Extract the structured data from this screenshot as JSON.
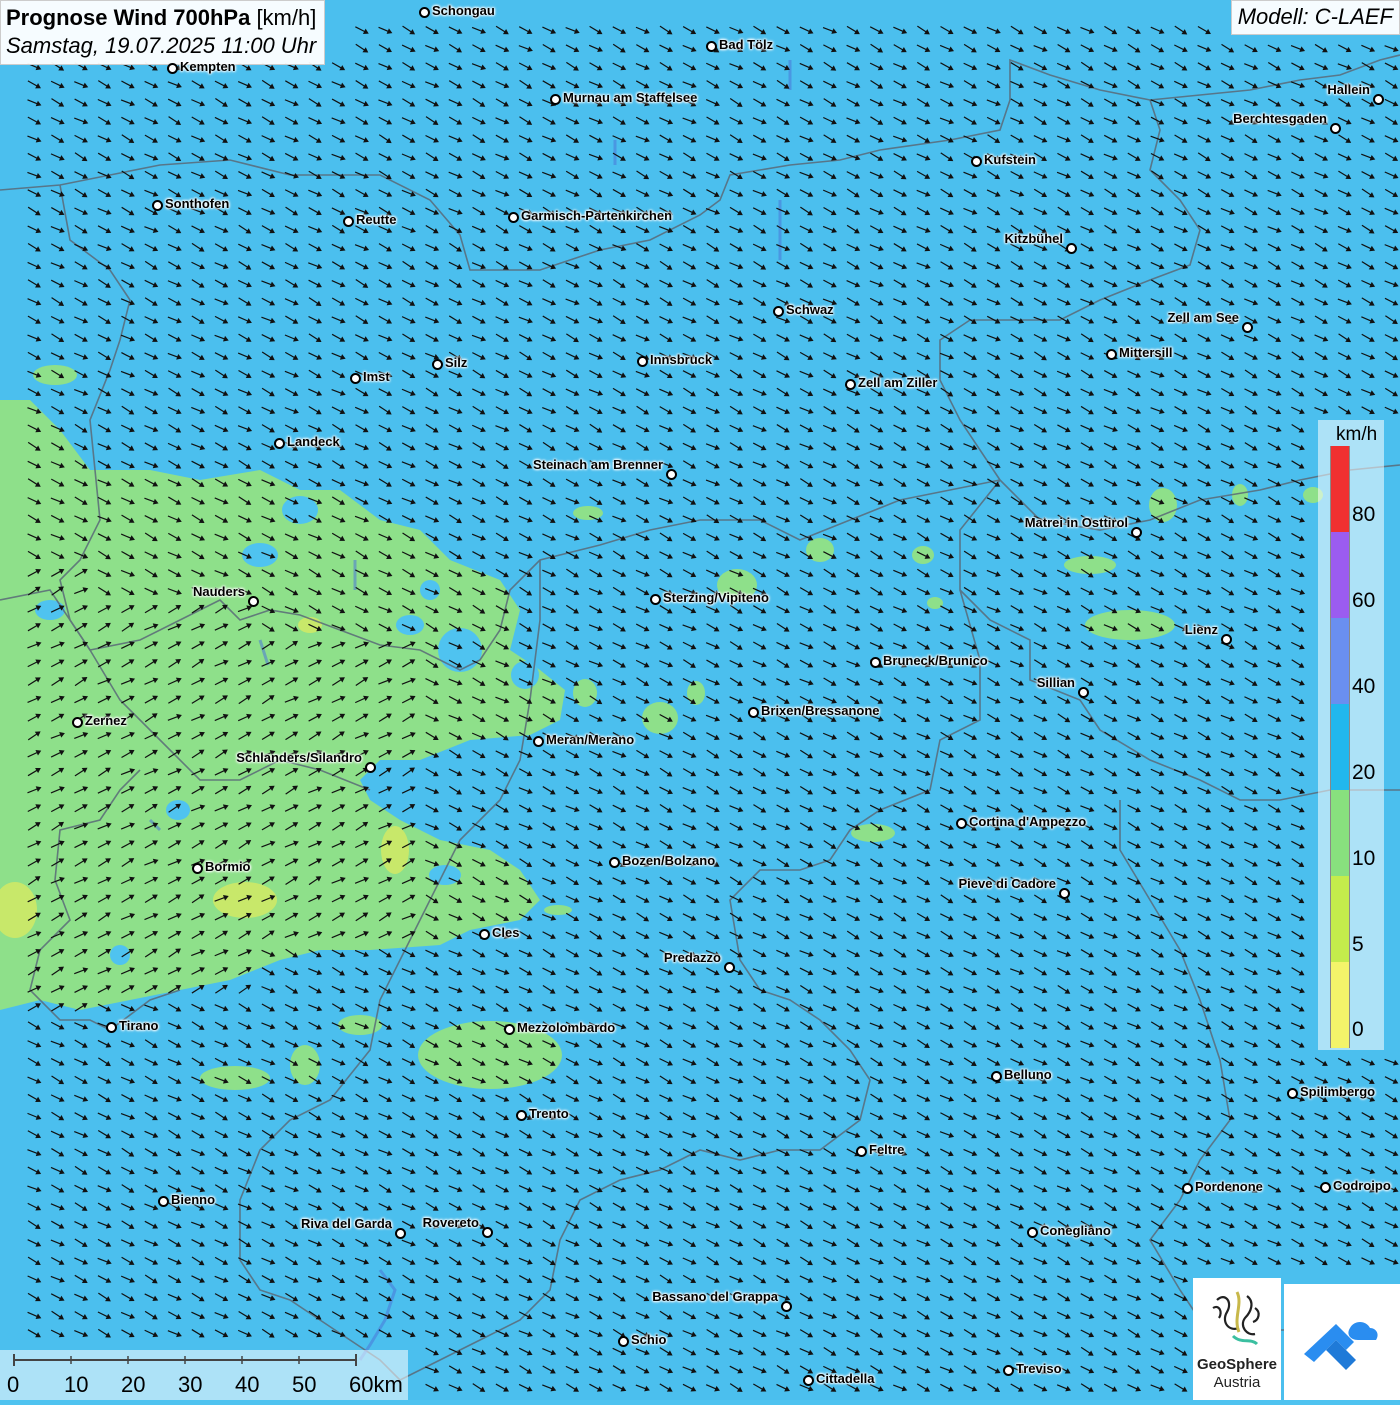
{
  "title": {
    "main": "Prognose Wind 700hPa",
    "unit": "[km/h]",
    "date": "Samstag, 19.07.2025 11:00 Uhr"
  },
  "model": "Modell: C-LAEF",
  "colors": {
    "background_20_40": "#4fc3f0",
    "band_10_20": "#8ee08a",
    "band_5_10": "#c8e86a",
    "arrow": "#111111"
  },
  "wind_direction": "from west-northwest (arrows pointing east-southeast); northeast-pointing over the southwest region",
  "cities": [
    {
      "name": "Schongau"
    },
    {
      "name": "Bad Tölz"
    },
    {
      "name": "Kempten"
    },
    {
      "name": "Murnau am Staffelsee"
    },
    {
      "name": "Hallein"
    },
    {
      "name": "Berchtesgaden"
    },
    {
      "name": "Kufstein"
    },
    {
      "name": "Sonthofen"
    },
    {
      "name": "Reutte"
    },
    {
      "name": "Garmisch-Partenkirchen"
    },
    {
      "name": "Kitzbühel"
    },
    {
      "name": "Schwaz"
    },
    {
      "name": "Zell am See"
    },
    {
      "name": "Mittersill"
    },
    {
      "name": "Innsbruck"
    },
    {
      "name": "Silz"
    },
    {
      "name": "Imst"
    },
    {
      "name": "Zell am Ziller"
    },
    {
      "name": "Landeck"
    },
    {
      "name": "Steinach am Brenner"
    },
    {
      "name": "Matrei in Osttirol"
    },
    {
      "name": "Nauders"
    },
    {
      "name": "Sterzing/Vipiteno"
    },
    {
      "name": "Lienz"
    },
    {
      "name": "Bruneck/Brunico"
    },
    {
      "name": "Sillian"
    },
    {
      "name": "Brixen/Bressanone"
    },
    {
      "name": "Zernez"
    },
    {
      "name": "Meran/Merano"
    },
    {
      "name": "Schlanders/Silandro"
    },
    {
      "name": "Cortina d'Ampezzo"
    },
    {
      "name": "Bozen/Bolzano"
    },
    {
      "name": "Bormio"
    },
    {
      "name": "Pieve di Cadore"
    },
    {
      "name": "Cles"
    },
    {
      "name": "Predazzo"
    },
    {
      "name": "Tirano"
    },
    {
      "name": "Mezzolombardo"
    },
    {
      "name": "Belluno"
    },
    {
      "name": "Spilimbergo"
    },
    {
      "name": "Trento"
    },
    {
      "name": "Feltre"
    },
    {
      "name": "Pordenone"
    },
    {
      "name": "Codroipo"
    },
    {
      "name": "Bienno"
    },
    {
      "name": "Riva del Garda"
    },
    {
      "name": "Rovereto"
    },
    {
      "name": "Conegliano"
    },
    {
      "name": "Bassano del Grappa"
    },
    {
      "name": "Schio"
    },
    {
      "name": "Treviso"
    },
    {
      "name": "Cittadella"
    }
  ],
  "legend": {
    "unit": "km/h",
    "labels": [
      "80",
      "60",
      "40",
      "20",
      "10",
      "5",
      "0"
    ],
    "bands": [
      {
        "color": "#f03030"
      },
      {
        "color": "#9b5cf0"
      },
      {
        "color": "#6a8ff0"
      },
      {
        "color": "#22b7ee"
      },
      {
        "color": "#88e07e"
      },
      {
        "color": "#c4ec4c"
      },
      {
        "color": "#f4f46a"
      }
    ]
  },
  "scale": {
    "labels": [
      "0",
      "10",
      "20",
      "30",
      "40",
      "50",
      "60km"
    ]
  },
  "logos": {
    "geosphere_line1": "GeoSphere",
    "geosphere_line2": "Austria"
  }
}
